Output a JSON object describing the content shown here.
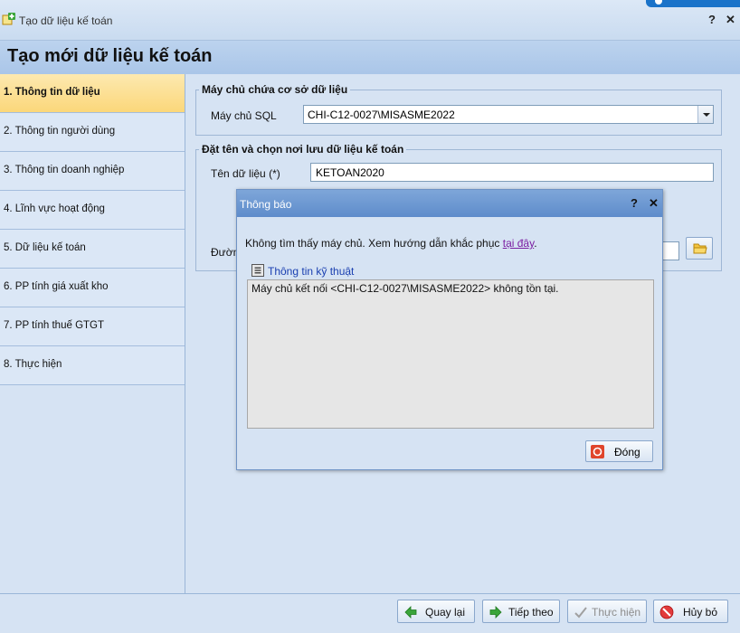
{
  "window": {
    "title": "Tạo dữ liệu kế toán",
    "help_label": "?",
    "close_label": "✕"
  },
  "header": {
    "page_title": "Tạo mới dữ liệu kế toán"
  },
  "sidebar": {
    "items": [
      {
        "label": "1. Thông tin dữ liệu",
        "active": true
      },
      {
        "label": "2. Thông tin người dùng"
      },
      {
        "label": "3. Thông tin doanh nghiệp"
      },
      {
        "label": "4. Lĩnh vực hoạt động"
      },
      {
        "label": "5. Dữ liệu kế toán"
      },
      {
        "label": "6. PP tính giá xuất kho"
      },
      {
        "label": "7. PP tính thuế GTGT"
      },
      {
        "label": "8. Thực hiện"
      }
    ]
  },
  "server_group": {
    "legend": "Máy chủ chứa cơ sở dữ liệu",
    "sql_label": "Máy chủ SQL",
    "sql_value": "CHI-C12-0027\\MISASME2022"
  },
  "naming_group": {
    "legend": "Đặt tên và chọn nơi lưu dữ liệu kế toán",
    "name_label": "Tên dữ liệu (*)",
    "name_value": "KETOAN2020",
    "path_label": "Đường"
  },
  "dialog": {
    "title": "Thông báo",
    "help_label": "?",
    "close_label": "✕",
    "message": "Không tìm thấy máy chủ. Xem hướng dẫn khắc phục ",
    "link_text": "tại đây",
    "message_end": ".",
    "tech_label": "Thông tin kỹ thuật",
    "tech_detail": "Máy chủ kết nối <CHI-C12-0027\\MISASME2022> không tồn tại.",
    "close_button": "Đóng"
  },
  "footer": {
    "back": "Quay lại",
    "next": "Tiếp theo",
    "execute": "Thực hiện",
    "cancel": "Hủy bỏ"
  },
  "colors": {
    "accent": "#1a73c9",
    "active_item": "#fbd77a",
    "dialog_title": "#5e8ccb",
    "link": "#7b1fa2"
  }
}
